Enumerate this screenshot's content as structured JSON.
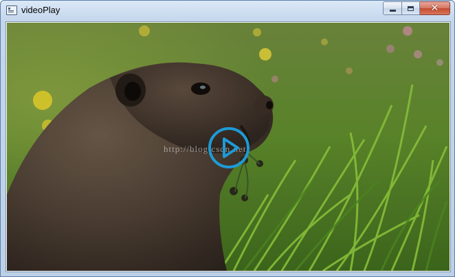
{
  "window": {
    "title": "videoPlay"
  },
  "controls": {
    "minimize": "minimize-icon",
    "maximize": "maximize-icon",
    "close": "close-icon",
    "close_glyph": "✕"
  },
  "video": {
    "watermark": "http://blog.csdn.net",
    "play_icon": "play-icon",
    "accent": "#1e9bd7"
  }
}
